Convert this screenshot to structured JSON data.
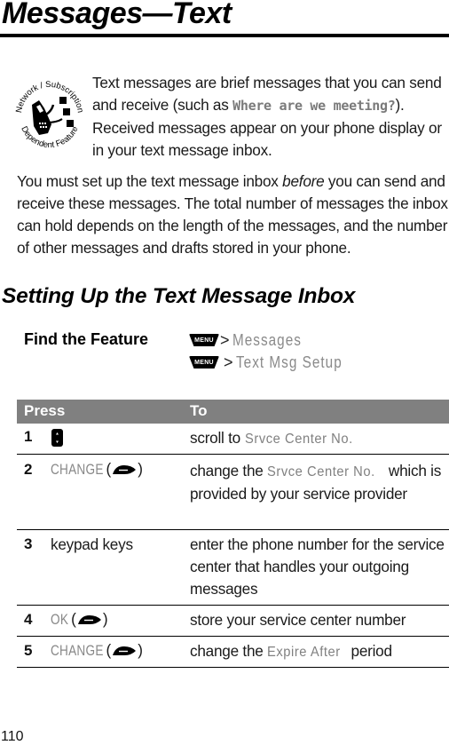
{
  "page": {
    "title": "Messages—Text",
    "page_number": "110"
  },
  "feature_badge": {
    "icon": "network-subscription-dependent-feature-icon",
    "top_text": "Network / Subscription",
    "bottom_text": "Dependent Feature"
  },
  "intro": {
    "text_before": "Text messages are brief messages that you can send and receive (such as ",
    "example": "Where are we meeting?",
    "text_after": "). Received messages appear on your phone display or in your text message inbox."
  },
  "paragraph2": {
    "text_before": "You must set up the text message inbox ",
    "emphasis": "before",
    "text_after": " you can send and receive these messages. The total number of messages the inbox can hold depends on the length of the messages, and the number of other messages and drafts stored in your phone."
  },
  "section": {
    "heading": "Setting Up the Text Message Inbox"
  },
  "find_the_feature": {
    "label": "Find the Feature",
    "menu_key_label": "MENU",
    "separator": ">",
    "paths": [
      "Messages",
      "Text Msg Setup"
    ]
  },
  "table": {
    "headers": {
      "press": "Press",
      "to": "To"
    },
    "rows": [
      {
        "num": "1",
        "press_icon": "nav-scroll-key-icon",
        "press": "",
        "to_before": "scroll to ",
        "to_code": "Srvce Center No.",
        "to_after": ""
      },
      {
        "num": "2",
        "press": "CHANGE",
        "press_icon": "softkey-icon",
        "to_before": "change the ",
        "to_code": "Srvce Center No.",
        "to_after": " which is provided by your service provider"
      },
      {
        "num": "3",
        "press": "keypad keys",
        "to_before": "enter the phone number for the service center that handles your outgoing messages",
        "to_code": "",
        "to_after": ""
      },
      {
        "num": "4",
        "press": "OK",
        "press_icon": "softkey-icon",
        "to_before": "store your service center number",
        "to_code": "",
        "to_after": ""
      },
      {
        "num": "5",
        "press": "CHANGE",
        "press_icon": "softkey-icon",
        "to_before": "change the ",
        "to_code": "Expire After",
        "to_after": " period"
      }
    ]
  }
}
